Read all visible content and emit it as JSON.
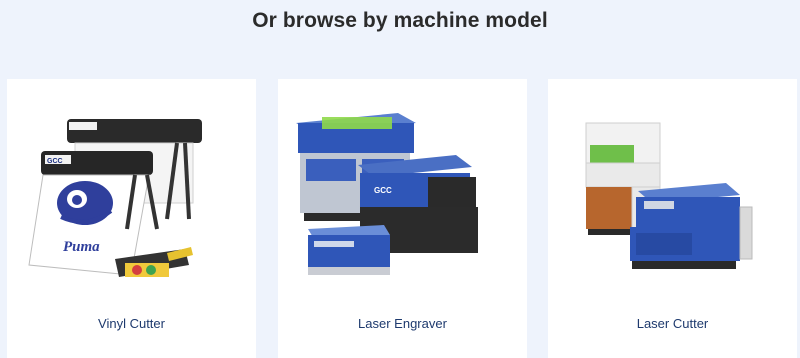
{
  "section": {
    "heading": "Or browse by machine model"
  },
  "cards": [
    {
      "label": "Vinyl Cutter",
      "image_icon": "vinyl-cutter-image"
    },
    {
      "label": "Laser Engraver",
      "image_icon": "laser-engraver-image"
    },
    {
      "label": "Laser Cutter",
      "image_icon": "laser-cutter-image"
    }
  ],
  "colors": {
    "page_background": "#eef3fc",
    "card_background": "#ffffff",
    "heading_text": "#2b2b2b",
    "label_text": "#1e3a6e",
    "machine_blue": "#2f56b8"
  }
}
